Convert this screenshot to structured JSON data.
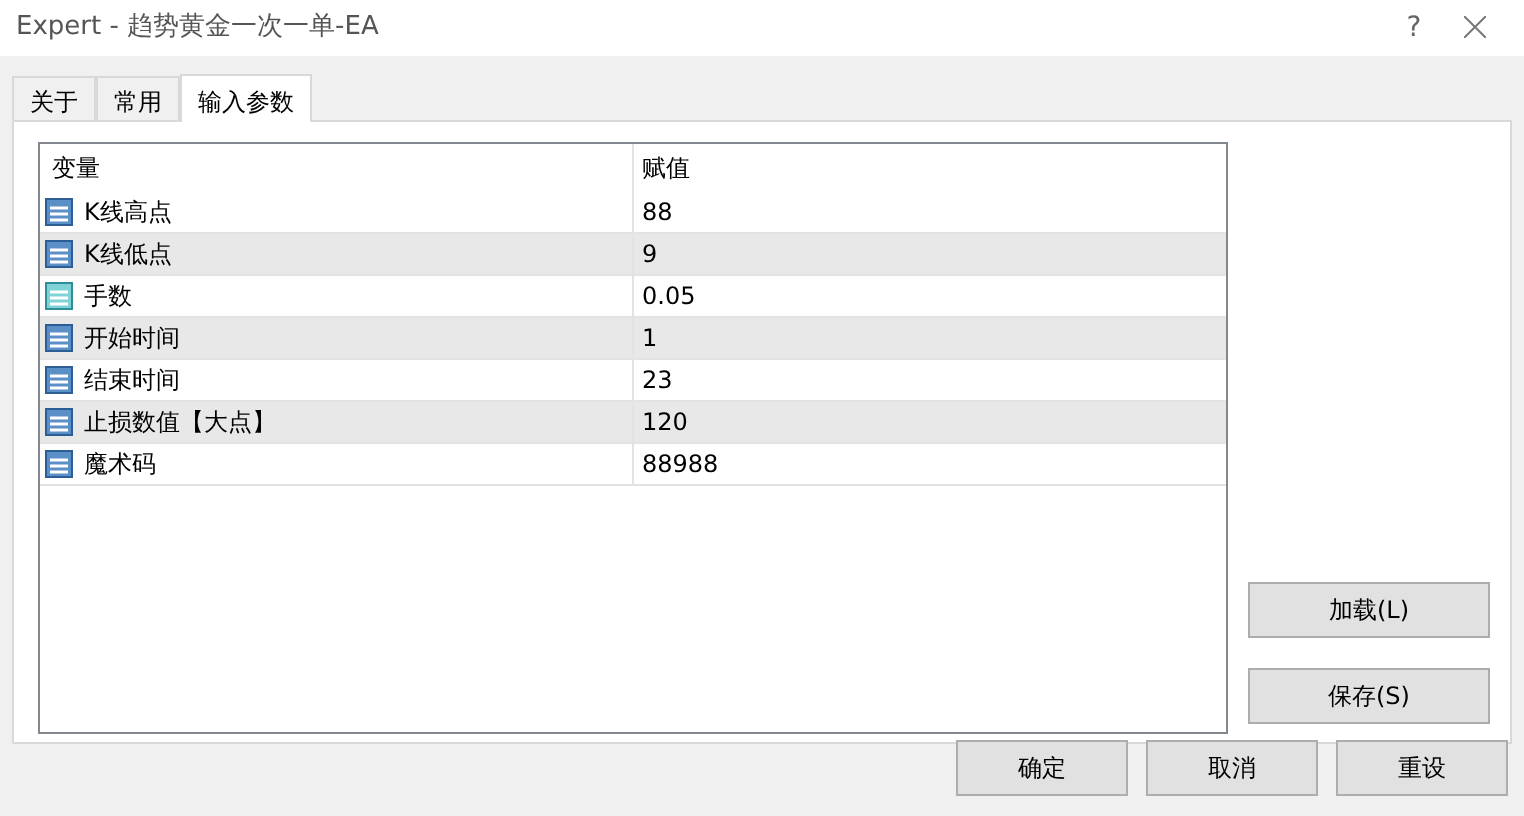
{
  "window": {
    "title": "Expert - 趋势黄金一次一单-EA",
    "help": "?"
  },
  "tabs": [
    {
      "label": "关于",
      "selected": false
    },
    {
      "label": "常用",
      "selected": false
    },
    {
      "label": "输入参数",
      "selected": true
    }
  ],
  "table": {
    "columns": [
      "变量",
      "赋值"
    ],
    "rows": [
      {
        "kind": "int",
        "name": "K线高点",
        "value": "88"
      },
      {
        "kind": "int",
        "name": "K线低点",
        "value": "9"
      },
      {
        "kind": "double",
        "name": "手数",
        "value": "0.05"
      },
      {
        "kind": "int",
        "name": "开始时间",
        "value": "1"
      },
      {
        "kind": "int",
        "name": "结束时间",
        "value": "23"
      },
      {
        "kind": "int",
        "name": "止损数值【大点】",
        "value": "120"
      },
      {
        "kind": "int",
        "name": "魔术码",
        "value": "88988"
      }
    ]
  },
  "side_buttons": [
    "加载(L)",
    "保存(S)"
  ],
  "buttons": [
    "确定",
    "取消",
    "重设"
  ]
}
